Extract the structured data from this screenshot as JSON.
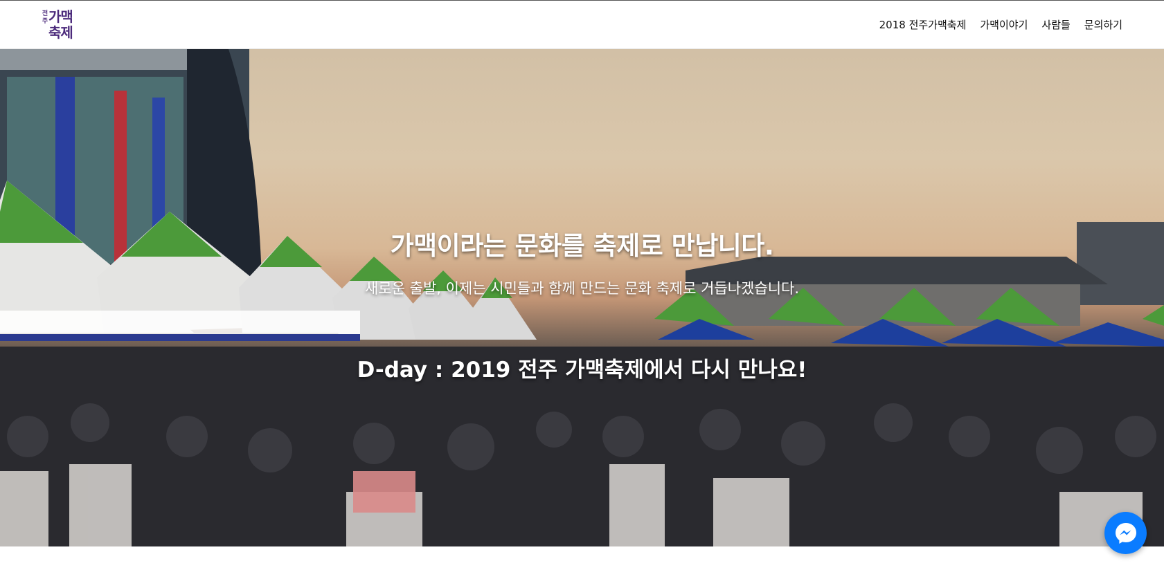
{
  "logo": {
    "small_text": "전주",
    "big_text": "가맥\n축제"
  },
  "nav": {
    "items": [
      "2018 전주가맥축제",
      "가맥이야기",
      "사람들",
      "문의하기"
    ]
  },
  "hero": {
    "headline": "가맥이라는 문화를 축제로 만납니다.",
    "subline": "새로운 출발, 이제는 시민들과 함께 만드는 문화 축제로 거듭나겠습니다.",
    "dday": "D-day : 2019 전주 가맥축제에서 다시 만나요!"
  },
  "messenger": {
    "icon": "messenger-icon",
    "color": "#0a7cff"
  }
}
